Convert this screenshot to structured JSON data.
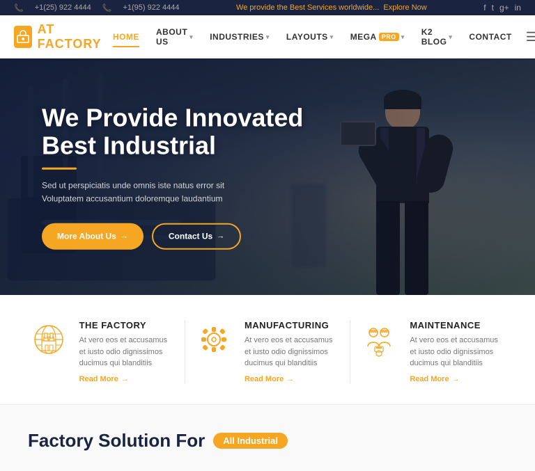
{
  "topbar": {
    "phone1": "+1(25) 922 4444",
    "phone2": "+1(95) 922 4444",
    "promo": "We provide the Best Services worldwide...",
    "explore": "Explore Now",
    "socials": [
      "f",
      "t",
      "g+",
      "in"
    ]
  },
  "header": {
    "logo_text": "AT FACTORY",
    "logo_letter": "AT",
    "nav": [
      {
        "label": "HOME",
        "active": true,
        "badge": null,
        "has_dropdown": false
      },
      {
        "label": "ABOUT US",
        "active": false,
        "badge": null,
        "has_dropdown": true
      },
      {
        "label": "INDUSTRIES",
        "active": false,
        "badge": null,
        "has_dropdown": true
      },
      {
        "label": "LAYOUTS",
        "active": false,
        "badge": null,
        "has_dropdown": true
      },
      {
        "label": "MEGA",
        "active": false,
        "badge": "PRO",
        "has_dropdown": true
      },
      {
        "label": "K2 BLOG",
        "active": false,
        "badge": null,
        "has_dropdown": true
      },
      {
        "label": "CONTACT",
        "active": false,
        "badge": null,
        "has_dropdown": false
      }
    ]
  },
  "hero": {
    "title_line1": "We Provide Innovated",
    "title_line2": "Best Industrial",
    "description": "Sed ut perspiciatis unde omnis iste natus error sit Voluptatem accusantium doloremque laudantium",
    "btn_primary": "More About Us",
    "btn_secondary": "Contact Us"
  },
  "services": [
    {
      "id": "factory",
      "title": "THE FACTORY",
      "description": "At vero eos et accusamus et iusto odio dignissimos ducimus qui blanditiis",
      "read_more": "Read More"
    },
    {
      "id": "manufacturing",
      "title": "MANUFACTURING",
      "description": "At vero eos et accusamus et iusto odio dignissimos ducimus qui blanditiis",
      "read_more": "Read More"
    },
    {
      "id": "maintenance",
      "title": "MAINTENANCE",
      "description": "At vero eos et accusamus et iusto odio dignissimos ducimus qui blanditiis",
      "read_more": "Read More"
    }
  ],
  "factory_solution": {
    "prefix": "Factory Solution For",
    "badge": "All Industrial"
  }
}
